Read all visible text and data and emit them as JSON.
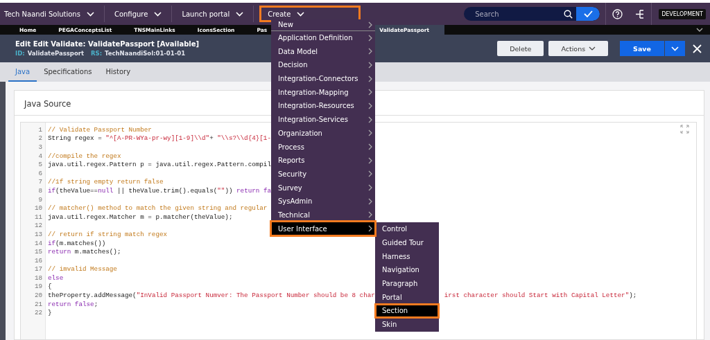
{
  "top_bar": {
    "menus": [
      {
        "label": "Tech Naandi Solutions",
        "selected": false
      },
      {
        "label": "Configure",
        "selected": false
      },
      {
        "label": "Launch portal",
        "selected": false
      },
      {
        "label": "Create",
        "selected": true
      }
    ],
    "search": {
      "placeholder": "Search"
    },
    "badge": "DEVELOPMENT"
  },
  "tabs": [
    {
      "label": "Home",
      "selected": false
    },
    {
      "label": "PEGAConceptsList",
      "selected": false
    },
    {
      "label": "TNSMainLinks",
      "selected": false
    },
    {
      "label": "IconsSection",
      "selected": false
    },
    {
      "label": "Pas",
      "selected": false
    },
    {
      "label": "ValidatePassport",
      "selected": true
    }
  ],
  "header": {
    "title": "Edit  Edit Validate: ValidatePassport [Available]",
    "id_label": "ID:",
    "id": "ValidatePassport",
    "rs_label": "RS:",
    "rs": "TechNaandiSol:01-01-01",
    "buttons": [
      {
        "label": "Delete",
        "kind": "plain"
      },
      {
        "label": "Actions",
        "kind": "dropdown"
      },
      {
        "label": "Save",
        "kind": "primary"
      }
    ]
  },
  "subtabs": [
    {
      "label": "Java",
      "selected": true
    },
    {
      "label": "Specifications",
      "selected": false
    },
    {
      "label": "History",
      "selected": false
    }
  ],
  "panel_title": "Java Source",
  "code": [
    {
      "n": "1",
      "segments": [
        {
          "kind": "comment",
          "text": "// Validate Passport Number"
        }
      ]
    },
    {
      "n": "2",
      "segments": [
        {
          "kind": "plain",
          "text": "String regex = "
        },
        {
          "kind": "string",
          "text": "\"^[A-PR-WYa-pr-wy][1-9]\\\\d\""
        },
        {
          "kind": "plain",
          "text": "+ "
        },
        {
          "kind": "string",
          "text": "\"\\\\s?\\\\d{4}[1-"
        }
      ]
    },
    {
      "n": "3"
    },
    {
      "n": "4",
      "segments": [
        {
          "kind": "comment",
          "text": "//compile the regex"
        }
      ]
    },
    {
      "n": "5",
      "segments": [
        {
          "kind": "plain",
          "text": "java.util.regex.Pattern p = java.util.regex.Pattern.compil"
        }
      ]
    },
    {
      "n": "6"
    },
    {
      "n": "7",
      "segments": [
        {
          "kind": "comment",
          "text": "//1f string empty return false"
        }
      ]
    },
    {
      "n": "8",
      "segments": [
        {
          "kind": "keyword",
          "text": "if"
        },
        {
          "kind": "plain",
          "text": "(theValue=="
        },
        {
          "kind": "keyword",
          "text": "null"
        },
        {
          "kind": "plain",
          "text": " || theValue.trim().equals("
        },
        {
          "kind": "string",
          "text": "\"\""
        },
        {
          "kind": "plain",
          "text": ")) "
        },
        {
          "kind": "keyword",
          "text": "return fa"
        }
      ]
    },
    {
      "n": "9"
    },
    {
      "n": "10",
      "segments": [
        {
          "kind": "comment",
          "text": "// matcher() method to match the given string and regular"
        }
      ]
    },
    {
      "n": "11",
      "segments": [
        {
          "kind": "plain",
          "text": "java.util.regex.Matcher m = p.matcher(theValue);"
        }
      ]
    },
    {
      "n": "12"
    },
    {
      "n": "13",
      "segments": [
        {
          "kind": "comment",
          "text": "// return if string match regex"
        }
      ]
    },
    {
      "n": "14",
      "segments": [
        {
          "kind": "keyword",
          "text": "if"
        },
        {
          "kind": "plain",
          "text": "(m.matches())"
        }
      ]
    },
    {
      "n": "15",
      "segments": [
        {
          "kind": "keyword",
          "text": "return"
        },
        {
          "kind": "plain",
          "text": " m.matches();"
        }
      ]
    },
    {
      "n": "16"
    },
    {
      "n": "17",
      "segments": [
        {
          "kind": "comment",
          "text": "// imvalid Message"
        }
      ]
    },
    {
      "n": "18",
      "segments": [
        {
          "kind": "keyword",
          "text": "else"
        }
      ]
    },
    {
      "n": "19",
      "segments": [
        {
          "kind": "plain",
          "text": "{"
        }
      ]
    },
    {
      "n": "20",
      "segments": [
        {
          "kind": "plain",
          "text": "theProperty.addMessage("
        },
        {
          "kind": "string",
          "text": "\"InValid Passport Numver: The Passport Number should be 8 char"
        }
      ],
      "segments_after": [
        {
          "kind": "string",
          "text": "irst character should Start with Capital Letter\""
        },
        {
          "kind": "plain",
          "text": ");"
        }
      ]
    },
    {
      "n": "21",
      "segments": [
        {
          "kind": "keyword",
          "text": "return false"
        },
        {
          "kind": "plain",
          "text": ";"
        }
      ]
    },
    {
      "n": "22",
      "segments": [
        {
          "kind": "plain",
          "text": "}"
        }
      ]
    }
  ],
  "create_menu": [
    {
      "label": "New",
      "selected": false
    },
    {
      "label": "Application Definition",
      "selected": false
    },
    {
      "label": "Data Model",
      "selected": false
    },
    {
      "label": "Decision",
      "selected": false
    },
    {
      "label": "Integration-Connectors",
      "selected": false
    },
    {
      "label": "Integration-Mapping",
      "selected": false
    },
    {
      "label": "Integration-Resources",
      "selected": false
    },
    {
      "label": "Integration-Services",
      "selected": false
    },
    {
      "label": "Organization",
      "selected": false
    },
    {
      "label": "Process",
      "selected": false
    },
    {
      "label": "Reports",
      "selected": false
    },
    {
      "label": "Security",
      "selected": false
    },
    {
      "label": "Survey",
      "selected": false
    },
    {
      "label": "SysAdmin",
      "selected": false
    },
    {
      "label": "Technical",
      "selected": false
    },
    {
      "label": "User Interface",
      "selected": true
    }
  ],
  "submenu": [
    {
      "label": "Control",
      "selected": false
    },
    {
      "label": "Guided Tour",
      "selected": false
    },
    {
      "label": "Harness",
      "selected": false
    },
    {
      "label": "Navigation",
      "selected": false
    },
    {
      "label": "Paragraph",
      "selected": false
    },
    {
      "label": "Portal",
      "selected": false
    },
    {
      "label": "Section",
      "selected": true
    },
    {
      "label": "Skin",
      "selected": false
    }
  ]
}
